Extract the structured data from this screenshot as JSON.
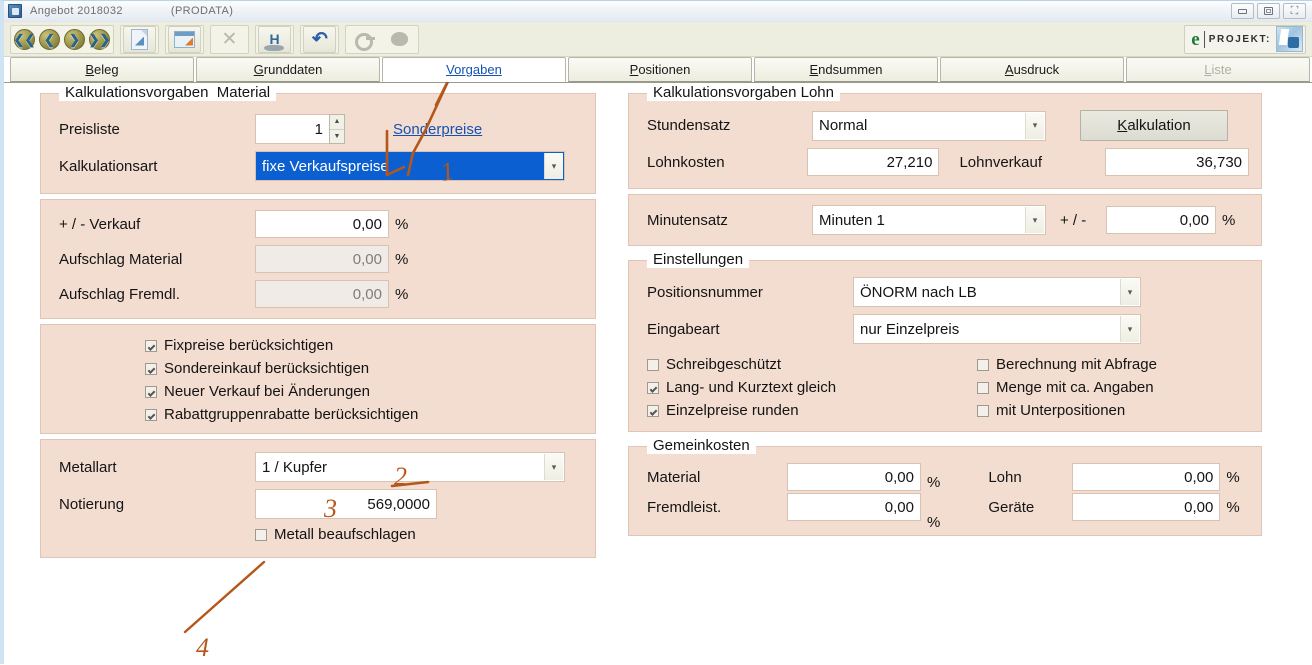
{
  "window": {
    "title": "Angebot  2018032",
    "database": "(PRODATA)",
    "buttons": {
      "minimize": "minimize-button",
      "maximize": "maximize-button",
      "close": "close-button"
    }
  },
  "toolbar": {
    "nav": [
      {
        "name": "first-record-button",
        "glyph": "«"
      },
      {
        "name": "previous-record-button",
        "glyph": "‹"
      },
      {
        "name": "next-record-button",
        "glyph": "›"
      },
      {
        "name": "last-record-button",
        "glyph": "»"
      }
    ],
    "items": [
      {
        "name": "new-document-button",
        "icon": "document-icon"
      },
      {
        "name": "edit-document-button",
        "icon": "edit-window-icon"
      },
      {
        "name": "delete-button",
        "icon": "close-x-icon"
      },
      {
        "name": "help-button",
        "icon": "h-stamp-icon"
      },
      {
        "name": "undo-button",
        "icon": "undo-arrow-icon"
      },
      {
        "name": "search-button",
        "icon": "key-icon"
      },
      {
        "name": "lock-button",
        "icon": "blob-icon"
      }
    ],
    "brand": {
      "e": "e",
      "label": "PROJEKT:"
    }
  },
  "tabs": [
    {
      "label": "Beleg",
      "accel": "B",
      "active": false,
      "disabled": false
    },
    {
      "label": "Grunddaten",
      "accel": "G",
      "active": false,
      "disabled": false
    },
    {
      "label": "Vorgaben",
      "accel": "V",
      "active": true,
      "disabled": false
    },
    {
      "label": "Positionen",
      "accel": "P",
      "active": false,
      "disabled": false
    },
    {
      "label": "Endsummen",
      "accel": "E",
      "active": false,
      "disabled": false
    },
    {
      "label": "Ausdruck",
      "accel": "A",
      "active": false,
      "disabled": false
    },
    {
      "label": "Liste",
      "accel": "L",
      "active": false,
      "disabled": true
    }
  ],
  "left": {
    "material_group": {
      "legend": "Kalkulationsvorgaben  Material",
      "preisliste_label": "Preisliste",
      "preisliste_value": "1",
      "sonderpreise_link": "Sonderpreise",
      "kalkulationsart_label": "Kalkulationsart",
      "kalkulationsart_value": "fixe Verkaufspreise"
    },
    "surcharge_group": {
      "verkauf_label": "+ / -   Verkauf",
      "verkauf_value": "0,00",
      "aufschlag_material_label": "Aufschlag Material",
      "aufschlag_material_value": "0,00",
      "aufschlag_fremdl_label": "Aufschlag Fremdl.",
      "aufschlag_fremdl_value": "0,00",
      "percent": "%"
    },
    "options_group": {
      "items": [
        {
          "label": "Fixpreise berücksichtigen",
          "checked": true
        },
        {
          "label": "Sondereinkauf berücksichtigen",
          "checked": true
        },
        {
          "label": "Neuer Verkauf bei Änderungen",
          "checked": true
        },
        {
          "label": "Rabattgruppenrabatte berücksichtigen",
          "checked": true
        }
      ]
    },
    "metal_group": {
      "metallart_label": "Metallart",
      "metallart_value": "1 / Kupfer",
      "notierung_label": "Notierung",
      "notierung_value": "569,0000",
      "metall_beaufschlagen_label": "Metall beaufschlagen",
      "metall_beaufschlagen_checked": false
    }
  },
  "right": {
    "lohn_group": {
      "legend": "Kalkulationsvorgaben Lohn",
      "stundensatz_label": "Stundensatz",
      "stundensatz_value": "Normal",
      "kalkulation_button": "Kalkulation",
      "kalkulation_accel": "K",
      "lohnkosten_label": "Lohnkosten",
      "lohnkosten_value": "27,210",
      "lohnverkauf_label": "Lohnverkauf",
      "lohnverkauf_value": "36,730"
    },
    "minuten_group": {
      "minutensatz_label": "Minutensatz",
      "minutensatz_value": "Minuten 1",
      "plusminus_label": "+ / -",
      "plusminus_value": "0,00",
      "percent": "%"
    },
    "einstellungen_group": {
      "legend": "Einstellungen",
      "positionsnummer_label": "Positionsnummer",
      "positionsnummer_value": "ÖNORM nach LB",
      "eingabeart_label": "Eingabeart",
      "eingabeart_value": "nur Einzelpreis",
      "checks_left": [
        {
          "label": "Schreibgeschützt",
          "checked": false
        },
        {
          "label": "Lang- und Kurztext gleich",
          "checked": true
        },
        {
          "label": "Einzelpreise runden",
          "checked": true
        }
      ],
      "checks_right": [
        {
          "label": "Berechnung mit Abfrage",
          "checked": false
        },
        {
          "label": "Menge mit ca. Angaben",
          "checked": false
        },
        {
          "label": "mit Unterpositionen",
          "checked": false
        }
      ]
    },
    "gemeinkosten_group": {
      "legend": "Gemeinkosten",
      "material_label": "Material",
      "material_value": "0,00",
      "fremdleist_label": "Fremdleist.",
      "fremdleist_value": "0,00",
      "lohn_label": "Lohn",
      "lohn_value": "0,00",
      "geraete_label": "Geräte",
      "geraete_value": "0,00",
      "percent": "%"
    }
  },
  "annotations": {
    "color": "#b5571a",
    "marks": [
      {
        "id": "1",
        "text": "1"
      },
      {
        "id": "2",
        "text": "2"
      },
      {
        "id": "3",
        "text": "3"
      },
      {
        "id": "4",
        "text": "4"
      }
    ]
  }
}
